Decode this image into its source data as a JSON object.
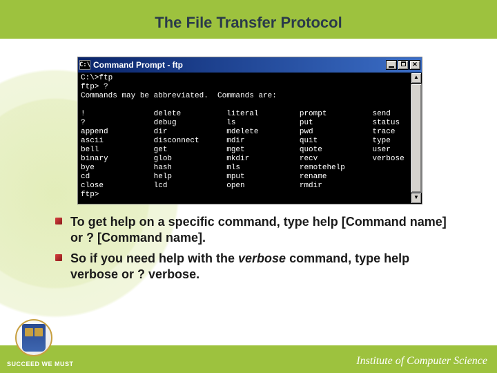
{
  "slide": {
    "title": "The File Transfer Protocol"
  },
  "window": {
    "icon_text": "C:\\",
    "title": "Command Prompt - ftp",
    "console_lines": [
      "C:\\>ftp",
      "ftp> ?",
      "Commands may be abbreviated.  Commands are:",
      "",
      "!               delete          literal         prompt          send",
      "?               debug           ls              put             status",
      "append          dir             mdelete         pwd             trace",
      "ascii           disconnect      mdir            quit            type",
      "bell            get             mget            quote           user",
      "binary          glob            mkdir           recv            verbose",
      "bye             hash            mls             remotehelp",
      "cd              help            mput            rename",
      "close           lcd             open            rmdir",
      "ftp>"
    ]
  },
  "bullets": [
    {
      "pre": "To get help on a specific command, type help [Command name] or ? [Command name]."
    },
    {
      "pre": "So if you need help with the ",
      "em": "verbose",
      "post": " command, type help verbose or ? verbose."
    }
  ],
  "footer": {
    "left": "SUCCEED WE MUST",
    "right": "Institute of Computer Science"
  }
}
